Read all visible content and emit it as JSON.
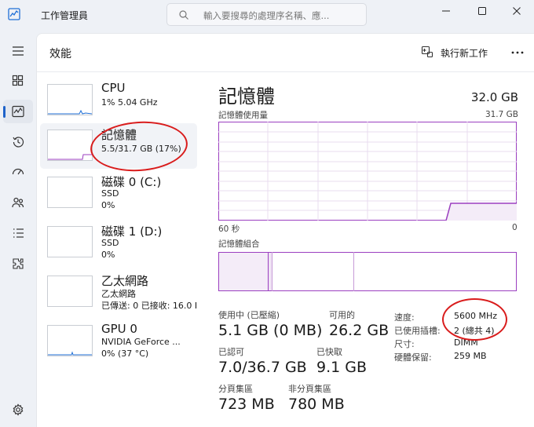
{
  "window": {
    "title": "工作管理員",
    "search_placeholder": "輸入要搜尋的處理序名稱、應..."
  },
  "header": {
    "page_title": "效能",
    "new_task_label": "執行新工作"
  },
  "processes": [
    {
      "name": "CPU",
      "line1": "1% 5.04 GHz",
      "line2": ""
    },
    {
      "name": "記憶體",
      "line1": "5.5/31.7 GB (17%)",
      "line2": ""
    },
    {
      "name": "磁碟 0 (C:)",
      "line1": "SSD",
      "line2": "0%"
    },
    {
      "name": "磁碟 1 (D:)",
      "line1": "SSD",
      "line2": "0%"
    },
    {
      "name": "乙太網路",
      "line1": "乙太網路",
      "line2": "已傳送: 0 已接收: 16.0 I"
    },
    {
      "name": "GPU 0",
      "line1": "NVIDIA GeForce ...",
      "line2": "0% (37 °C)"
    }
  ],
  "memory": {
    "title": "記憶體",
    "total": "32.0 GB",
    "usage_label": "記憶體使用量",
    "usage_max": "31.7 GB",
    "time_left": "60 秒",
    "time_right": "0",
    "composition_label": "記憶體組合",
    "stats": {
      "in_use": {
        "label": "使用中 (已壓縮)",
        "value": "5.1 GB (0 MB)"
      },
      "available": {
        "label": "可用的",
        "value": "26.2 GB"
      },
      "committed": {
        "label": "已認可",
        "value": "7.0/36.7 GB"
      },
      "cached": {
        "label": "已快取",
        "value": "9.1 GB"
      },
      "paged_pool": {
        "label": "分頁集區",
        "value": "723 MB"
      },
      "nonpaged_pool": {
        "label": "非分頁集區",
        "value": "780 MB"
      }
    },
    "specs": [
      {
        "key": "速度:",
        "value": "5600 MHz"
      },
      {
        "key": "已使用插槽:",
        "value": "2 (總共 4)"
      },
      {
        "key": "尺寸:",
        "value": "DIMM"
      },
      {
        "key": "硬體保留:",
        "value": "259 MB"
      }
    ]
  },
  "colors": {
    "memory_accent": "#9b3fc0",
    "annotation": "#d91c1c"
  }
}
